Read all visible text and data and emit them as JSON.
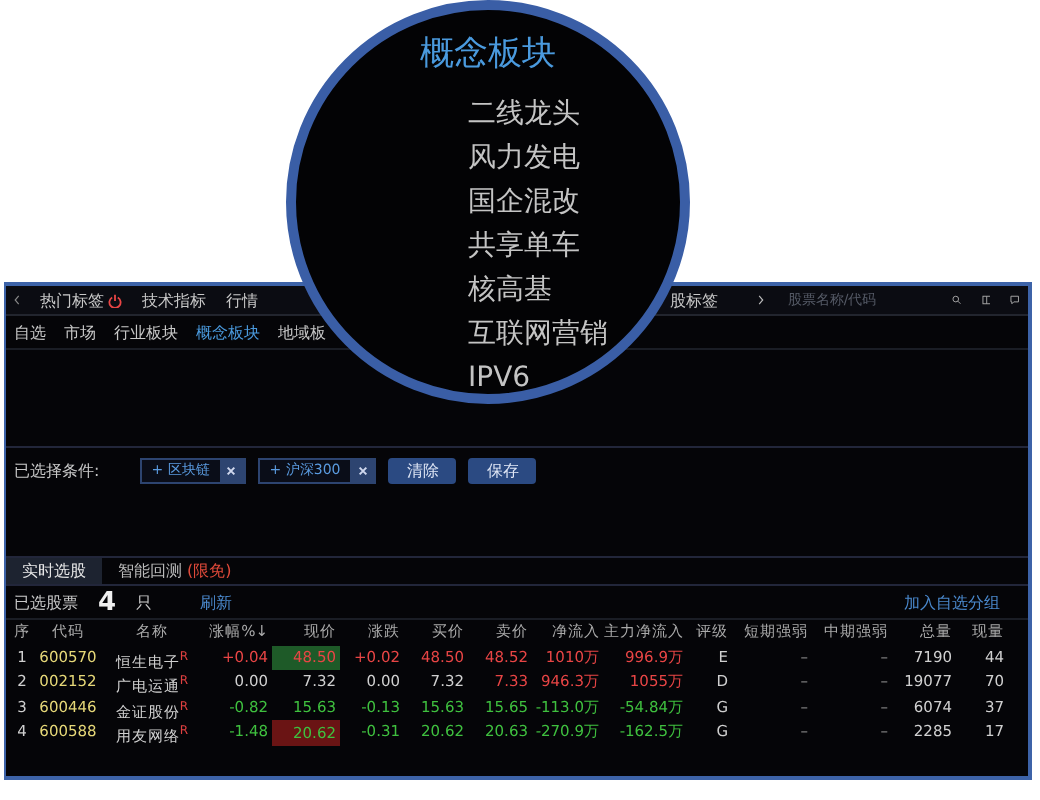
{
  "magnifier": {
    "heading": "概念板块",
    "items": [
      "二线龙头",
      "风力发电",
      "国企混改",
      "共享单车",
      "核高基",
      "互联网营销",
      "IPV6"
    ]
  },
  "top_tabs": [
    {
      "label": "热门标签",
      "kind": "hot",
      "selected": false
    },
    {
      "label": "技术指标",
      "kind": "plain",
      "selected": false
    },
    {
      "label": "行情",
      "kind": "plain",
      "selected": false
    },
    {
      "label": "股标签",
      "kind": "plain",
      "selected": false
    }
  ],
  "search": {
    "placeholder": "股票名称/代码"
  },
  "sub_tabs": [
    {
      "label": "自选",
      "selected": false
    },
    {
      "label": "市场",
      "selected": false
    },
    {
      "label": "行业板块",
      "selected": false
    },
    {
      "label": "概念板块",
      "selected": true
    },
    {
      "label": "地域板",
      "selected": false
    }
  ],
  "conditions": {
    "label": "已选择条件:",
    "chips": [
      "+ 区块链",
      "+ 沪深300"
    ],
    "buttons": [
      "清除",
      "保存"
    ]
  },
  "result_tabs": [
    {
      "label": "实时选股",
      "selected": true
    },
    {
      "label": "智能回测",
      "note": "(限免)",
      "selected": false
    }
  ],
  "summary": {
    "label": "已选股票",
    "count": "4",
    "unit": "只",
    "refresh": "刷新",
    "add_group": "加入自选分组"
  },
  "table": {
    "columns": [
      "序",
      "代码",
      "名称",
      "涨幅%↓",
      "现价",
      "涨跌",
      "买价",
      "卖价",
      "净流入",
      "主力净流入",
      "评级",
      "短期强弱",
      "中期强弱",
      "总量",
      "现量"
    ],
    "rows": [
      {
        "index": "1",
        "code": "600570",
        "name": "恒生电子",
        "marker": "R",
        "values": [
          {
            "text": "+0.04",
            "color": "#e84545"
          },
          {
            "text": "48.50",
            "color": "#e84545",
            "highlight": {
              "color": "#1e5a28"
            }
          },
          {
            "text": "+0.02",
            "color": "#e84545"
          },
          {
            "text": "48.50",
            "color": "#e84545"
          },
          {
            "text": "48.52",
            "color": "#e84545"
          },
          {
            "text": "1010万",
            "color": "#e84545"
          },
          {
            "text": "996.9万",
            "color": "#e84545"
          },
          {
            "text": "E",
            "color": "#d0d0d0"
          },
          {
            "text": "–"
          },
          {
            "text": "–"
          },
          {
            "text": "7190",
            "color": "#d0d0d0"
          },
          {
            "text": "44",
            "color": "#d0d0d0"
          }
        ]
      },
      {
        "index": "2",
        "code": "002152",
        "name": "广电运通",
        "marker": "R",
        "values": [
          {
            "text": "0.00",
            "color": "#d0d0d0"
          },
          {
            "text": "7.32",
            "color": "#d0d0d0"
          },
          {
            "text": "0.00",
            "color": "#d0d0d0"
          },
          {
            "text": "7.32",
            "color": "#d0d0d0"
          },
          {
            "text": "7.33",
            "color": "#e84545"
          },
          {
            "text": "946.3万",
            "color": "#e84545"
          },
          {
            "text": "1055万",
            "color": "#e84545"
          },
          {
            "text": "D",
            "color": "#d0d0d0"
          },
          {
            "text": "–"
          },
          {
            "text": "–"
          },
          {
            "text": "19077",
            "color": "#d0d0d0"
          },
          {
            "text": "70",
            "color": "#d0d0d0"
          }
        ]
      },
      {
        "index": "3",
        "code": "600446",
        "name": "金证股份",
        "marker": "R",
        "values": [
          {
            "text": "-0.82",
            "color": "#3fc03f"
          },
          {
            "text": "15.63",
            "color": "#3fc03f"
          },
          {
            "text": "-0.13",
            "color": "#3fc03f"
          },
          {
            "text": "15.63",
            "color": "#3fc03f"
          },
          {
            "text": "15.65",
            "color": "#3fc03f"
          },
          {
            "text": "-113.0万",
            "color": "#3fc03f"
          },
          {
            "text": "-54.84万",
            "color": "#3fc03f"
          },
          {
            "text": "G",
            "color": "#d0d0d0"
          },
          {
            "text": "–"
          },
          {
            "text": "–"
          },
          {
            "text": "6074",
            "color": "#d0d0d0"
          },
          {
            "text": "37",
            "color": "#d0d0d0"
          }
        ]
      },
      {
        "index": "4",
        "code": "600588",
        "name": "用友网络",
        "marker": "R",
        "values": [
          {
            "text": "-1.48",
            "color": "#3fc03f"
          },
          {
            "text": "20.62",
            "color": "#3fc03f",
            "highlight": {
              "color": "#6a1414"
            }
          },
          {
            "text": "-0.31",
            "color": "#3fc03f"
          },
          {
            "text": "20.62",
            "color": "#3fc03f"
          },
          {
            "text": "20.63",
            "color": "#3fc03f"
          },
          {
            "text": "-270.9万",
            "color": "#3fc03f"
          },
          {
            "text": "-162.5万",
            "color": "#3fc03f"
          },
          {
            "text": "G",
            "color": "#d0d0d0"
          },
          {
            "text": "–"
          },
          {
            "text": "–"
          },
          {
            "text": "2285",
            "color": "#d0d0d0"
          },
          {
            "text": "17",
            "color": "#d0d0d0"
          }
        ]
      }
    ]
  }
}
